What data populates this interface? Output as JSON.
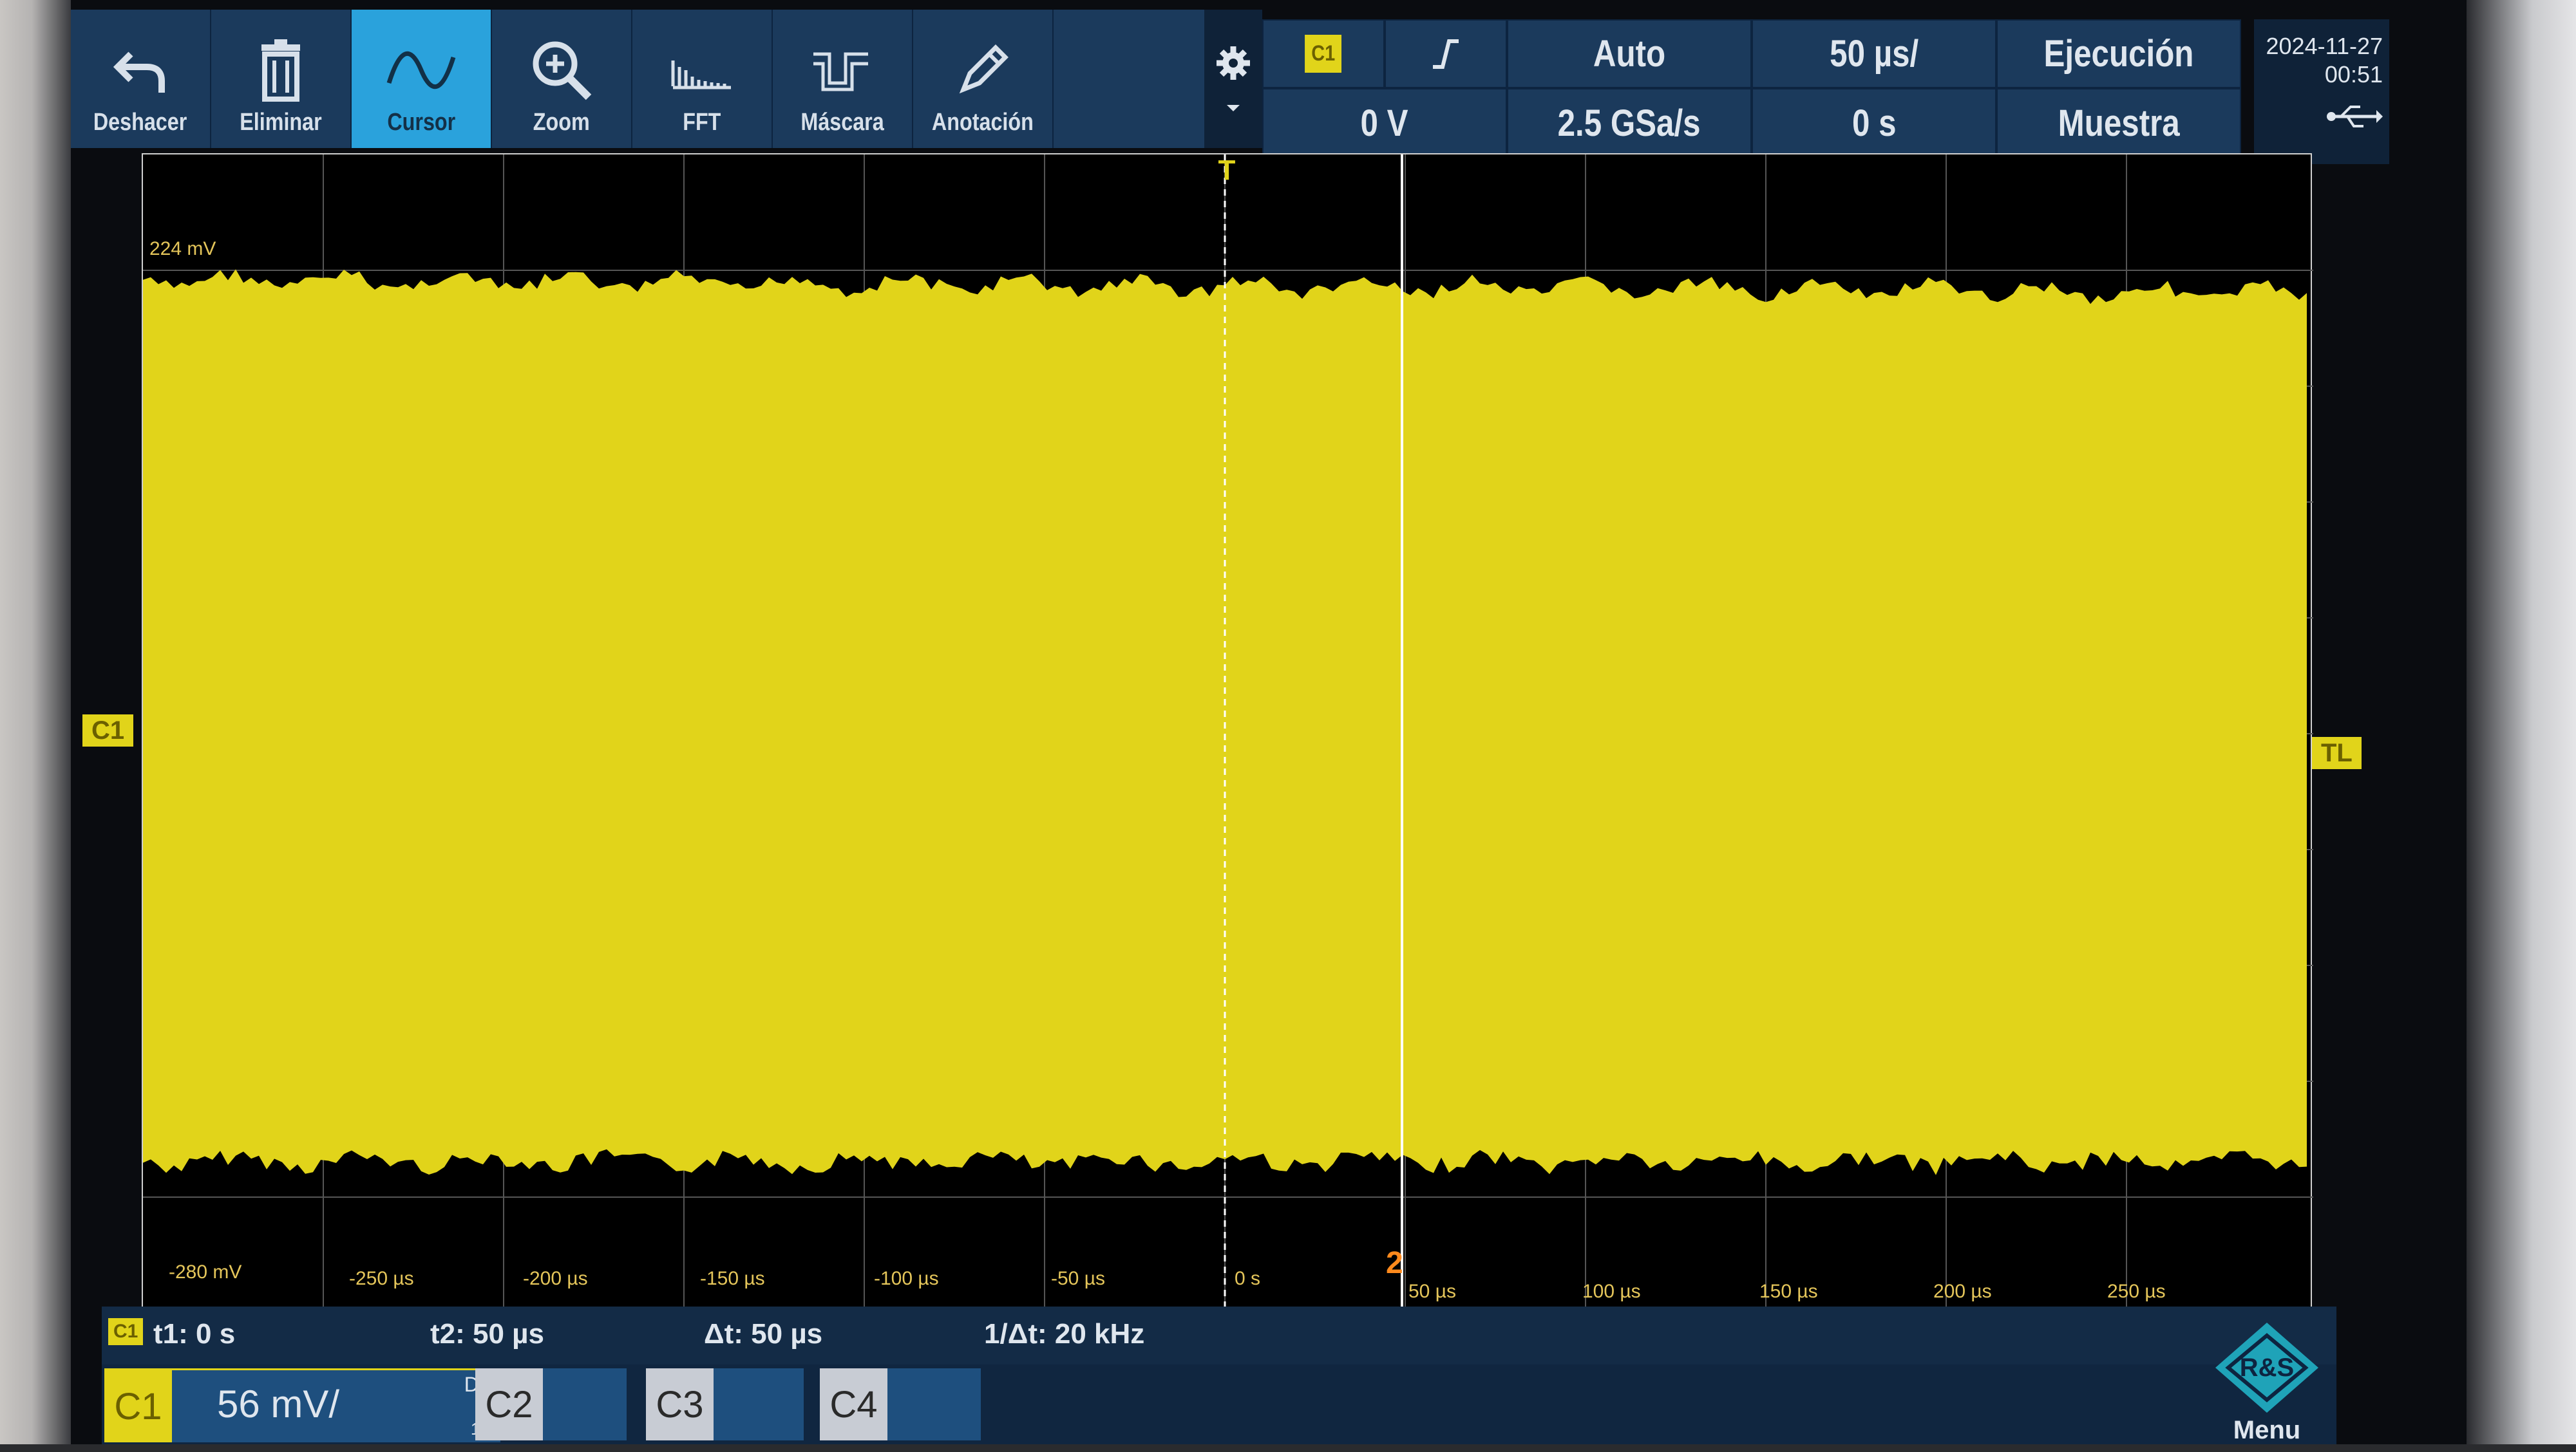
{
  "toolbar": {
    "items": [
      {
        "label": "Deshacer",
        "icon": "undo-icon"
      },
      {
        "label": "Eliminar",
        "icon": "trash-icon"
      },
      {
        "label": "Cursor",
        "icon": "cursor-icon",
        "active": true
      },
      {
        "label": "Zoom",
        "icon": "zoom-icon"
      },
      {
        "label": "FFT",
        "icon": "fft-icon"
      },
      {
        "label": "Máscara",
        "icon": "mask-icon"
      },
      {
        "label": "Anotación",
        "icon": "pencil-icon"
      }
    ]
  },
  "trigger": {
    "source": "C1",
    "slope_icon": "rising-edge-icon",
    "level": "0 V",
    "mode": "Auto",
    "sample_rate": "2.5 GSa/s",
    "timebase": "50 µs/",
    "position": "0 s",
    "run_state": "Ejecución",
    "acq_mode": "Muestra"
  },
  "datetime": {
    "date": "2024-11-27",
    "time": "00:51"
  },
  "display": {
    "trace_color": "#e1d41a",
    "y_labels": [
      "224 mV",
      "-280 mV"
    ],
    "x_labels": [
      "-250 µs",
      "-200 µs",
      "-150 µs",
      "-100 µs",
      "-50 µs",
      "0 s",
      "50 µs",
      "100 µs",
      "150 µs",
      "200 µs",
      "250 µs"
    ],
    "ch_marker": "C1",
    "trigger_level_marker": "TL",
    "trigger_marker": "T",
    "cursor2_marker": "2"
  },
  "cursor": {
    "badge": "C1",
    "t1": "t1: 0 s",
    "t2": "t2: 50 µs",
    "dt": "Δt: 50 µs",
    "inv_dt": "1/Δt: 20 kHz"
  },
  "channels": {
    "c1": {
      "label": "C1",
      "scale": "56 mV/",
      "coupling": "DC",
      "probe": "1:1"
    },
    "c2": {
      "label": "C2"
    },
    "c3": {
      "label": "C3"
    },
    "c4": {
      "label": "C4"
    },
    "menu": "Menu"
  }
}
